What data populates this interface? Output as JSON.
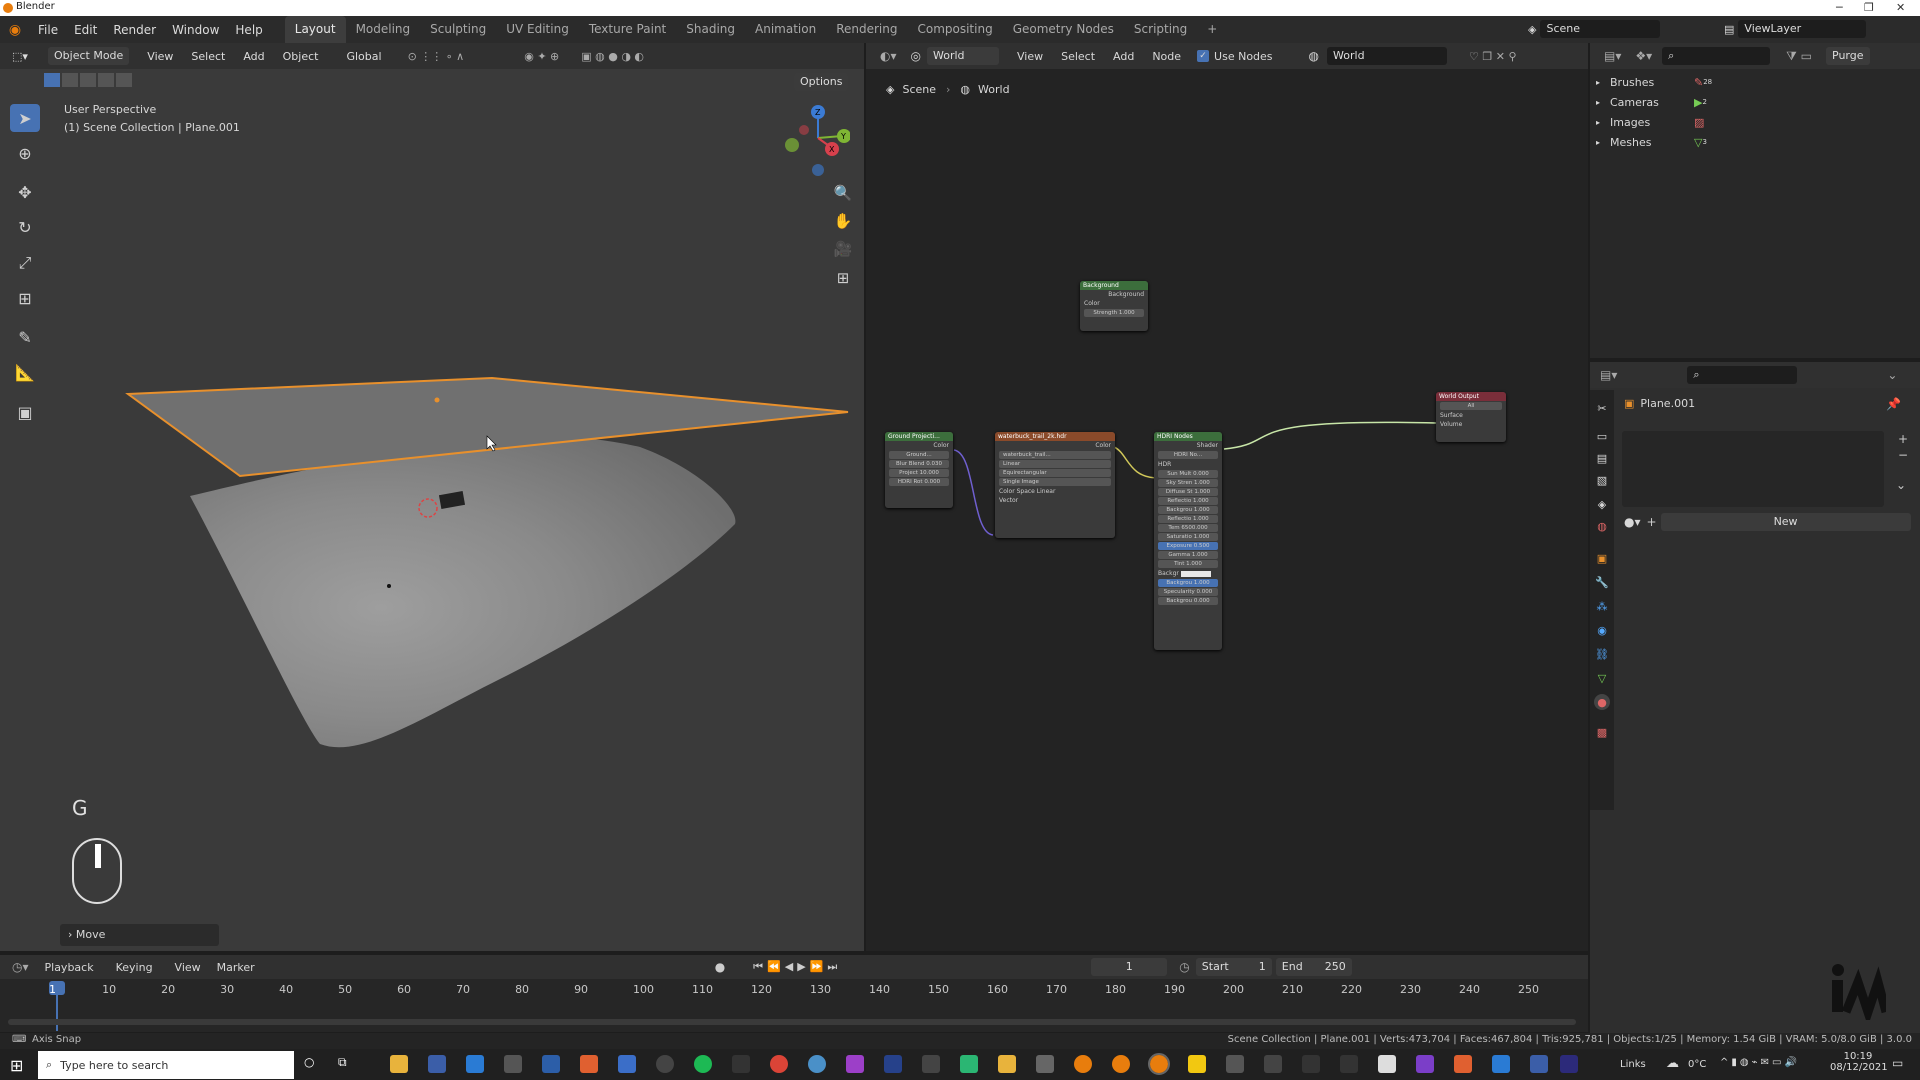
{
  "window": {
    "title": "Blender"
  },
  "menus": [
    "File",
    "Edit",
    "Render",
    "Window",
    "Help"
  ],
  "workspaces": [
    "Layout",
    "Modeling",
    "Sculpting",
    "UV Editing",
    "Texture Paint",
    "Shading",
    "Animation",
    "Rendering",
    "Compositing",
    "Geometry Nodes",
    "Scripting"
  ],
  "active_workspace": "Layout",
  "scene": "Scene",
  "view_layer": "ViewLayer",
  "viewport": {
    "mode": "Object Mode",
    "menus": [
      "View",
      "Select",
      "Add",
      "Object"
    ],
    "transform": "Global",
    "options": "Options",
    "perspective": "User Perspective",
    "collection": "(1) Scene Collection | Plane.001",
    "key_overlay": "G",
    "last_op": "Move"
  },
  "node_editor": {
    "type": "World",
    "menus": [
      "View",
      "Select",
      "Add",
      "Node"
    ],
    "use_nodes": "Use Nodes",
    "world": "World",
    "breadcrumb": [
      "Scene",
      "World"
    ],
    "nodes": {
      "background": {
        "title": "Background",
        "out": "Background",
        "rows": [
          "Color"
        ],
        "slider": "Strength  1.000"
      },
      "world_output": {
        "title": "World Output",
        "select": "All",
        "rows": [
          "Surface",
          "Volume"
        ]
      },
      "ground": {
        "title": "Ground Projecti...",
        "out": "Color",
        "sliders": [
          "Blur Blend 0.030",
          "Project  10.000",
          "HDRI Rot  0.000"
        ]
      },
      "texture": {
        "title": "waterbuck_trail_2k.hdr",
        "out": "Color",
        "rows": [
          "Linear",
          "Equirectangular",
          "Single Image",
          "Color Space",
          "Vector"
        ],
        "color_space": "Linear",
        "image": "waterbuck_trail..."
      },
      "hdri": {
        "title": "HDRI Nodes",
        "out": "Shader",
        "select": "HDRI No...",
        "rows": [
          "HDR"
        ],
        "sliders": [
          "Sun Mult 0.000",
          "Sky Stren 1.000",
          "Diffuse St 1.000",
          "Reflectio 1.000",
          "Backgrou 1.000",
          "Reflectio 1.000",
          "Tem 6500.000",
          "Saturatio 1.000",
          "Exposure 0.500",
          "Gamma 1.000",
          "Tint 1.000",
          "Backgr",
          "Backgrou 1.000",
          "Specularity 0.000",
          "Backgrou 0.000"
        ]
      }
    }
  },
  "outliner": {
    "items": [
      "Brushes",
      "Cameras",
      "Images",
      "Meshes"
    ],
    "counts": [
      "28",
      "2",
      "",
      "3"
    ],
    "purge": "Purge"
  },
  "properties": {
    "object": "Plane.001",
    "new_btn": "New"
  },
  "timeline": {
    "menus": [
      "Playback",
      "Keying",
      "View",
      "Marker"
    ],
    "current": "1",
    "start_label": "Start",
    "start": "1",
    "end_label": "End",
    "end": "250",
    "ticks": [
      "1",
      "10",
      "20",
      "30",
      "40",
      "50",
      "60",
      "70",
      "80",
      "90",
      "100",
      "110",
      "120",
      "130",
      "140",
      "150",
      "160",
      "170",
      "180",
      "190",
      "200",
      "210",
      "220",
      "230",
      "240",
      "250"
    ]
  },
  "status": {
    "left": "Axis Snap",
    "right": "Scene Collection | Plane.001 | Verts:473,704 | Faces:467,804 | Tris:925,781 | Objects:1/25 | Memory: 1.54 GiB | VRAM: 5.0/8.0 GiB | 3.0.0"
  },
  "taskbar": {
    "search": "Type here to search",
    "links": "Links",
    "temp": "0°C",
    "time": "10:19",
    "date": "08/12/2021"
  }
}
